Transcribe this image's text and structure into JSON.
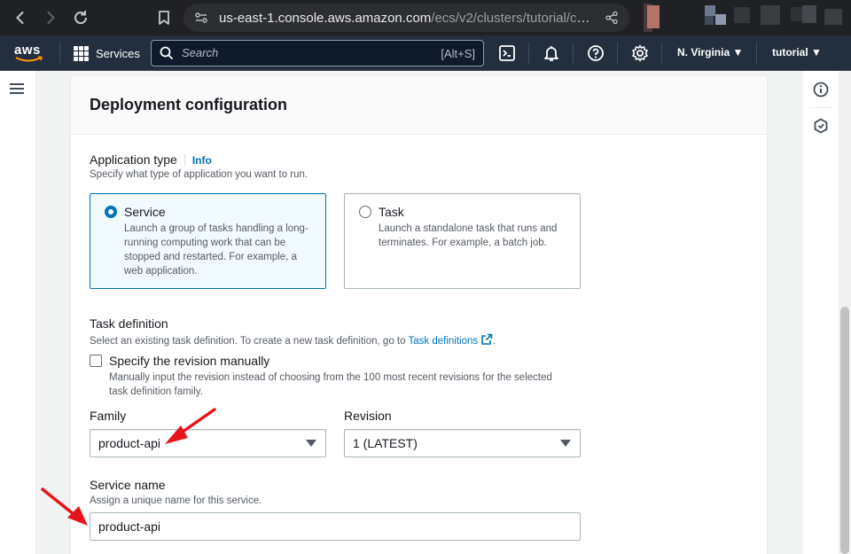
{
  "browser": {
    "url_host": "us-east-1.console.aws.amazon.com",
    "url_path": "/ecs/v2/clusters/tutorial/creat…"
  },
  "aws_nav": {
    "logo_text": "aws",
    "services_label": "Services",
    "search_placeholder": "Search",
    "search_shortcut": "[Alt+S]",
    "region_label": "N. Virginia ▼",
    "account_label": "tutorial ▼",
    "icons": [
      "cloudshell-icon",
      "notifications-icon",
      "help-icon",
      "settings-icon"
    ]
  },
  "panel": {
    "title": "Deployment configuration"
  },
  "application_type": {
    "label": "Application type",
    "info_link": "Info",
    "description": "Specify what type of application you want to run.",
    "options": [
      {
        "title": "Service",
        "description": "Launch a group of tasks handling a long-running computing work that can be stopped and restarted. For example, a web application.",
        "selected": true
      },
      {
        "title": "Task",
        "description": "Launch a standalone task that runs and terminates. For example, a batch job.",
        "selected": false
      }
    ]
  },
  "task_definition": {
    "label": "Task definition",
    "description_prefix": "Select an existing task definition. To create a new task definition, go to ",
    "description_link": "Task definitions",
    "description_suffix": ".",
    "specify_revision_label": "Specify the revision manually",
    "specify_revision_checked": false,
    "specify_revision_description": "Manually input the revision instead of choosing from the 100 most recent revisions for the selected task definition family.",
    "family_label": "Family",
    "family_value": "product-api",
    "revision_label": "Revision",
    "revision_value": "1 (LATEST)"
  },
  "service_name": {
    "label": "Service name",
    "description": "Assign a unique name for this service.",
    "value": "product-api"
  },
  "colors": {
    "aws_nav_bg": "#232f3e",
    "link_blue": "#0073bb",
    "selected_tile_bg": "#f1faff",
    "annotation_arrow": "#e8141b"
  }
}
